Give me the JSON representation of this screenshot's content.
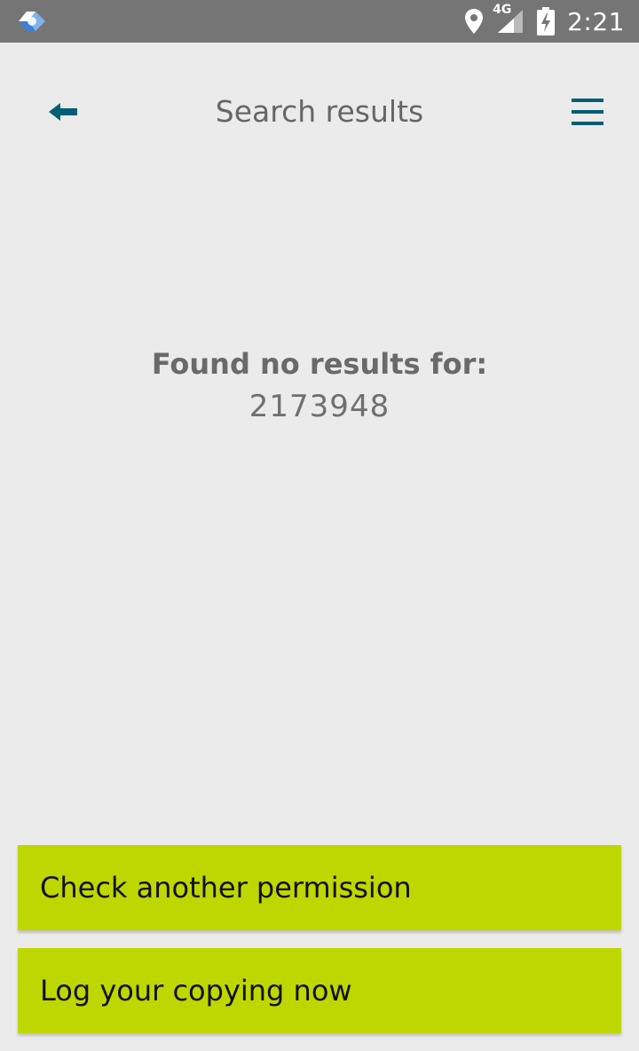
{
  "status_bar": {
    "app_icon": "app-logo-icon",
    "icons": [
      "location-icon",
      "signal-4g-icon",
      "battery-charging-icon"
    ],
    "network_label": "4G",
    "time": "2:21"
  },
  "header": {
    "title": "Search results",
    "back_icon": "back-arrow-icon",
    "menu_icon": "hamburger-menu-icon",
    "accent_color": "#005f73"
  },
  "results": {
    "heading": "Found no results for:",
    "query": "2173948"
  },
  "actions": {
    "check_label": "Check another permission",
    "log_label": "Log your copying now",
    "button_color": "#bfd700"
  }
}
